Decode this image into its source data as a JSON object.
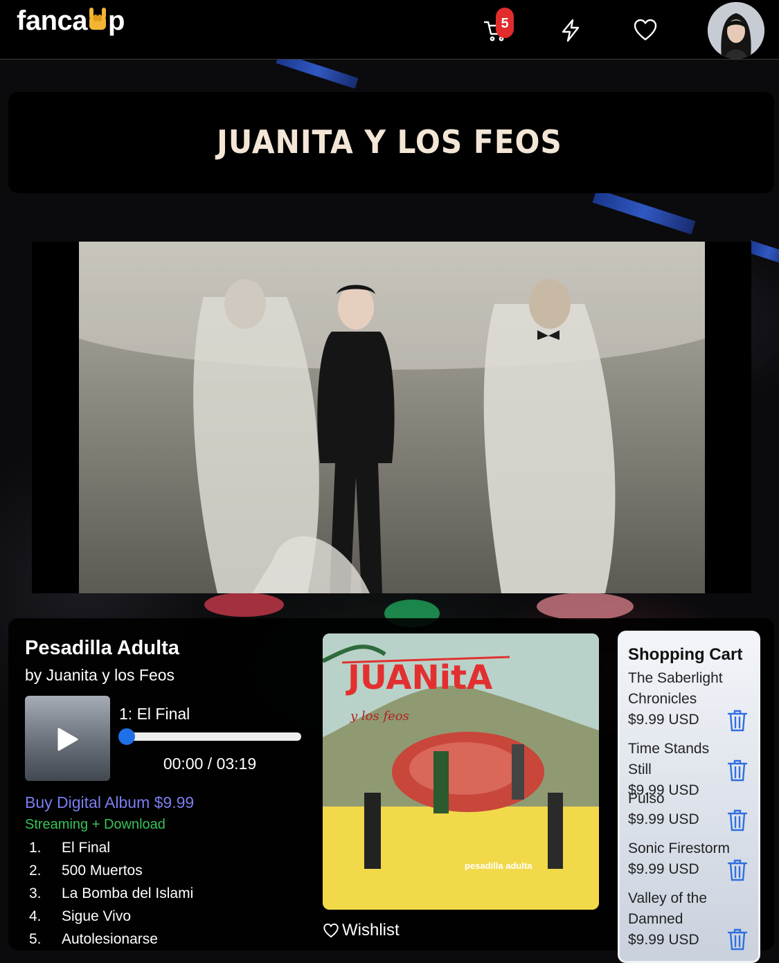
{
  "header": {
    "logo_prefix": "fanca",
    "logo_suffix": "p",
    "cart_count": "5",
    "icons": [
      "cart-icon",
      "lightning-icon",
      "heart-icon"
    ]
  },
  "artist": {
    "name": "JUANITA Y LOS FEOS"
  },
  "album": {
    "title": "Pesadilla Adulta",
    "by": "by Juanita y los Feos",
    "now_playing": "1: El Final",
    "time": "00:00 / 03:19",
    "progress": 0,
    "buy_label": "Buy Digital Album $9.99",
    "format_label": "Streaming + Download",
    "cover_lettering": "JUANitA",
    "cover_sub": "y los feos",
    "cover_caption": "pesadilla adulta",
    "wishlist_label": "Wishlist",
    "tracks": [
      {
        "num": "1.",
        "title": "El Final"
      },
      {
        "num": "2.",
        "title": "500 Muertos"
      },
      {
        "num": "3.",
        "title": "La Bomba del Islami"
      },
      {
        "num": "4.",
        "title": "Sigue Vivo"
      },
      {
        "num": "5.",
        "title": "Autolesionarse"
      }
    ]
  },
  "cart": {
    "title": "Shopping Cart",
    "items": [
      {
        "name": "The Saberlight Chronicles",
        "price": "$9.99 USD"
      },
      {
        "name": "Time Stands Still",
        "price": "$9.99 USD"
      },
      {
        "name": "Pulso",
        "price": "$9.99 USD"
      },
      {
        "name": "Sonic Firestorm",
        "price": "$9.99 USD"
      },
      {
        "name": "Valley of the Damned",
        "price": "$9.99 USD"
      }
    ]
  },
  "colors": {
    "accent_link": "#7a7ef0",
    "stream_green": "#37c35a",
    "badge_red": "#e12c2c",
    "trash_blue": "#2f6fe0"
  }
}
